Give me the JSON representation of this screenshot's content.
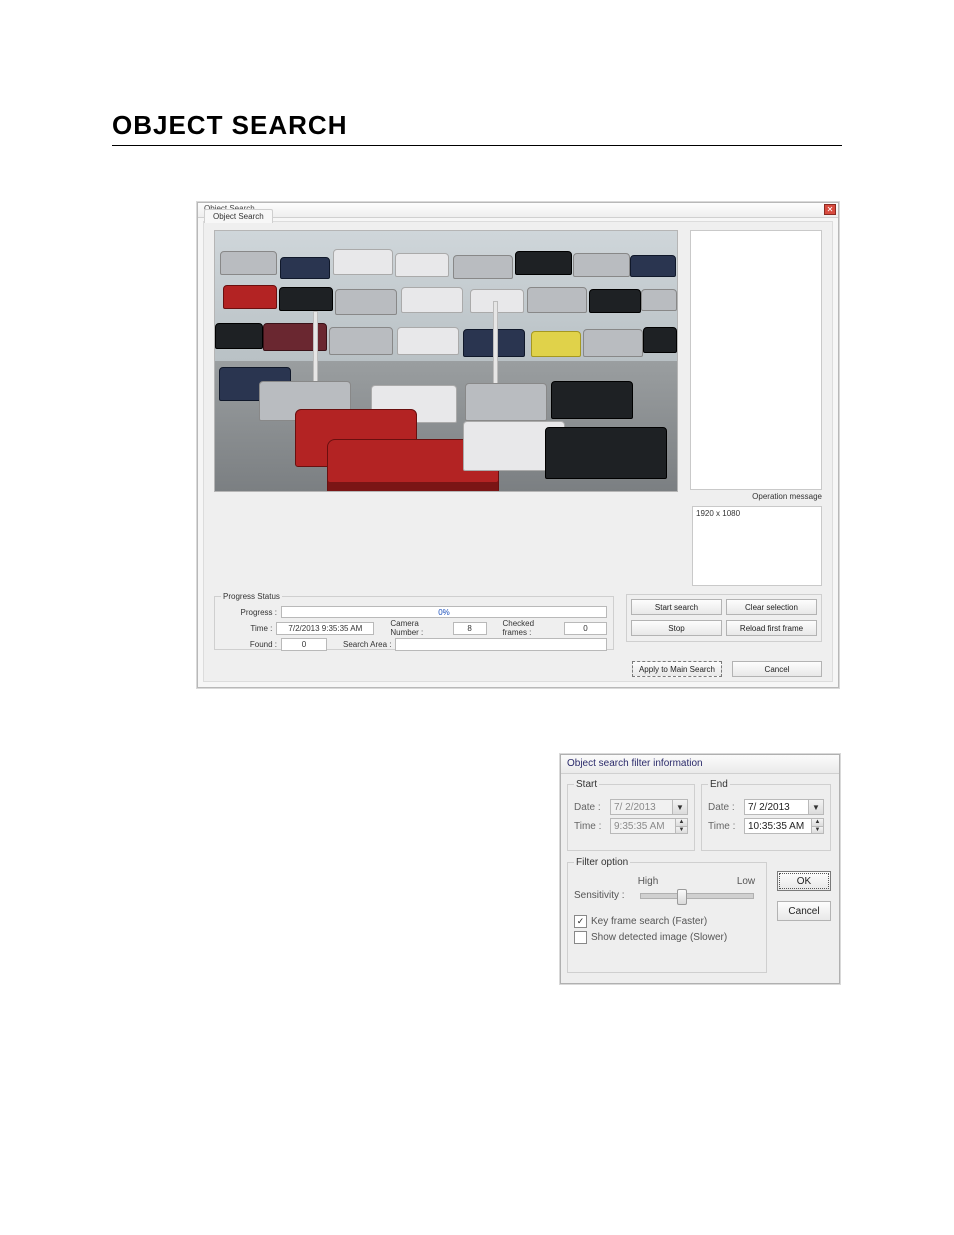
{
  "page": {
    "section_title": "OBJECT SEARCH"
  },
  "win1": {
    "title": "Object Search",
    "tab": "Object Search",
    "operation_message_label": "Operation message",
    "resolution": "1920 x 1080",
    "progress": {
      "legend": "Progress Status",
      "progress_label": "Progress :",
      "progress_pct": "0%",
      "time_label": "Time :",
      "time_value": "7/2/2013 9:35:35 AM",
      "camera_label": "Camera Number :",
      "camera_value": "8",
      "checked_label": "Checked frames :",
      "checked_value": "0",
      "found_label": "Found :",
      "found_value": "0",
      "area_label": "Search Area :"
    },
    "buttons": {
      "start": "Start search",
      "clear": "Clear selection",
      "stop": "Stop",
      "reload": "Reload first frame",
      "apply": "Apply to Main Search",
      "cancel": "Cancel"
    }
  },
  "win2": {
    "title": "Object search filter information",
    "start": {
      "legend": "Start",
      "date_label": "Date :",
      "date_value": "7/ 2/2013",
      "time_label": "Time :",
      "time_value": "9:35:35 AM"
    },
    "end": {
      "legend": "End",
      "date_label": "Date :",
      "date_value": "7/ 2/2013",
      "time_label": "Time :",
      "time_value": "10:35:35 AM"
    },
    "filter": {
      "legend": "Filter option",
      "sensitivity_label": "Sensitivity :",
      "high": "High",
      "low": "Low",
      "keyframe": "Key frame search (Faster)",
      "showdetected": "Show detected image (Slower)"
    },
    "buttons": {
      "ok": "OK",
      "cancel": "Cancel"
    }
  }
}
